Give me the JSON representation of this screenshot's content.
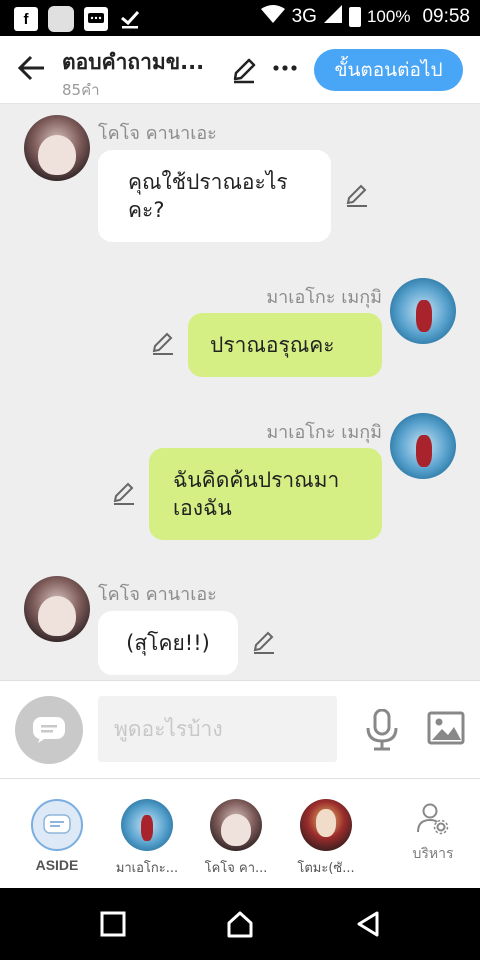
{
  "status_bar": {
    "icons": [
      "facebook-icon",
      "app-icon",
      "message-icon",
      "download-done-icon"
    ],
    "network": "3G",
    "battery": "100%",
    "time": "09:58"
  },
  "header": {
    "title": "ตอบคำถามข...",
    "subtitle": "85คำ",
    "next_label": "ขั้นตอนต่อไป"
  },
  "messages": [
    {
      "side": "left",
      "sender": "โคโจ คานาเอะ",
      "text": "คุณใช้ปราณอะไรคะ?"
    },
    {
      "side": "right",
      "sender": "มาเอโกะ เมกุมิ",
      "text": "ปราณอรุณคะ"
    },
    {
      "side": "right",
      "sender": "มาเอโกะ เมกุมิ",
      "text": "ฉันคิดค้นปราณมาเองฉัน"
    },
    {
      "side": "left",
      "sender": "โคโจ คานาเอะ",
      "text": "(สุโคย!!)"
    }
  ],
  "input": {
    "placeholder": "พูดอะไรบ้าง"
  },
  "characters": [
    {
      "name": "ASIDE"
    },
    {
      "name": "มาเอโกะ..."
    },
    {
      "name": "โคโจ คา..."
    },
    {
      "name": "โตมะ(ซั..."
    }
  ],
  "manage_label": "บริหาร",
  "colors": {
    "accent": "#49a5f5",
    "bubble_right": "#d5ef84",
    "bubble_left": "#ffffff",
    "background": "#eeeeee"
  }
}
